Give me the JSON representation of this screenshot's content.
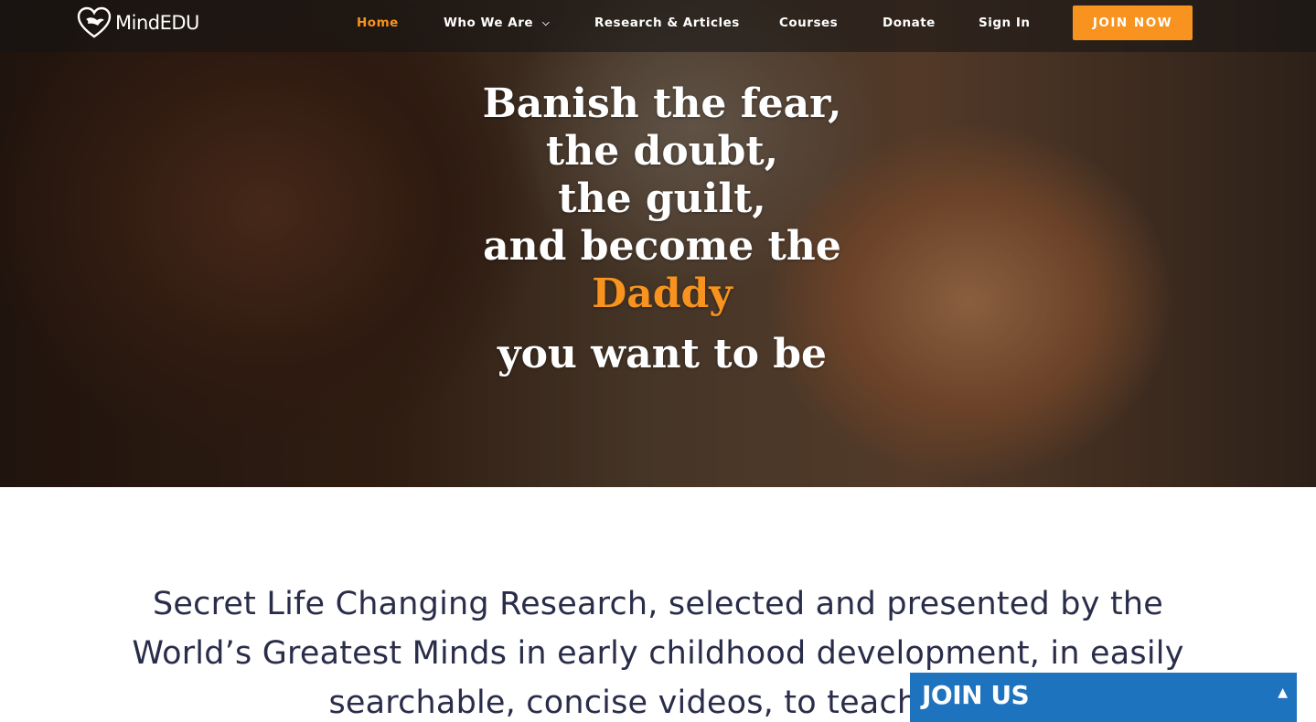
{
  "brand": {
    "name": "MindEDU",
    "logo_icon": "heart-dove-icon"
  },
  "nav": {
    "items": [
      {
        "label": "Home",
        "active": true
      },
      {
        "label": "Who We Are",
        "dropdown": true
      },
      {
        "label": "Research & Articles"
      },
      {
        "label": "Courses"
      },
      {
        "label": "Donate"
      },
      {
        "label": "Sign In"
      }
    ],
    "cta": "JOIN NOW"
  },
  "hero": {
    "lines": [
      "Banish the fear,",
      "the doubt,",
      "the guilt,",
      "and become the"
    ],
    "accent_word": "Daddy",
    "last_line": "you want to be"
  },
  "lead": {
    "text": "Secret Life Changing Research, selected and presented by the World’s Greatest Minds in early childhood development, in easily searchable, concise videos, to teach you"
  },
  "join_widget": {
    "title": "JOIN US",
    "toggle_icon": "caret-up-icon"
  },
  "colors": {
    "accent": "#f7931e",
    "widget_blue": "#1e73be",
    "lead_text": "#2a2d4a"
  }
}
